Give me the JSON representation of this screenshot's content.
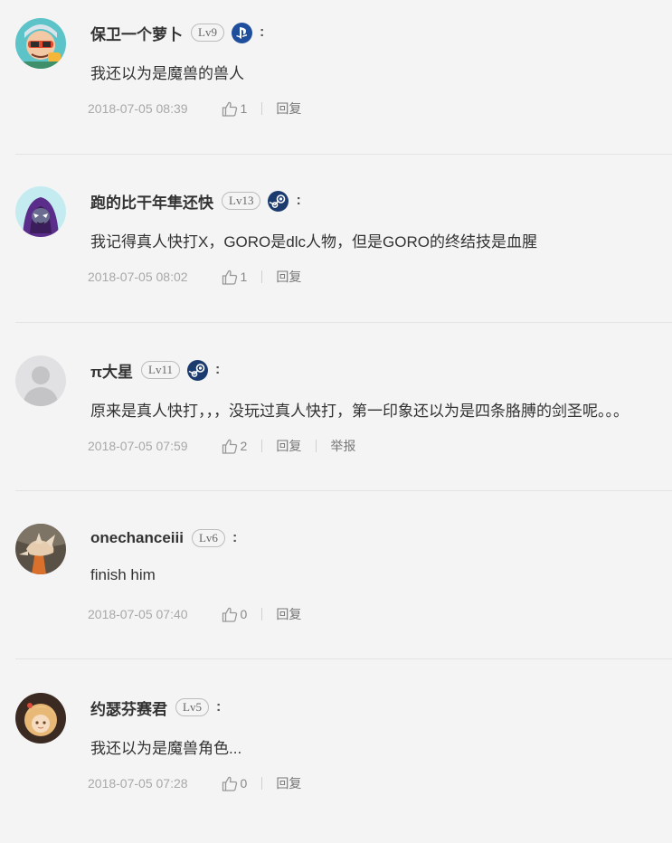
{
  "comments": [
    {
      "username": "保卫一个萝卜",
      "level": "Lv9",
      "platform_icon": "playstation-icon",
      "colon": ":",
      "content": "我还以为是魔兽的兽人",
      "timestamp": "2018-07-05 08:39",
      "likes": "1",
      "reply_label": "回复"
    },
    {
      "username": "跑的比干年隼还快",
      "level": "Lv13",
      "platform_icon": "steam-icon",
      "colon": ":",
      "content": "我记得真人快打X，GORO是dlc人物，但是GORO的终结技是血腥",
      "timestamp": "2018-07-05 08:02",
      "likes": "1",
      "reply_label": "回复"
    },
    {
      "username": "π大星",
      "level": "Lv11",
      "platform_icon": "steam-icon",
      "colon": ":",
      "content": "原来是真人快打，，，没玩过真人快打，第一印象还以为是四条胳膊的剑圣呢。。。",
      "timestamp": "2018-07-05 07:59",
      "likes": "2",
      "reply_label": "回复",
      "report_label": "举报"
    },
    {
      "username": "onechanceiii",
      "level": "Lv6",
      "colon": ":",
      "content": "finish him",
      "timestamp": "2018-07-05 07:40",
      "likes": "0",
      "reply_label": "回复"
    },
    {
      "username": "约瑟芬赛君",
      "level": "Lv5",
      "colon": ":",
      "content": "我还以为是魔兽角色...",
      "timestamp": "2018-07-05 07:28",
      "likes": "0",
      "reply_label": "回复"
    }
  ],
  "colors": {
    "background": "#f4f4f5",
    "text": "#333333",
    "meta": "#a8a8a8",
    "separator": "#e3e3e5",
    "steam": "#1b3b6f",
    "playstation": "#1f4f9c"
  }
}
